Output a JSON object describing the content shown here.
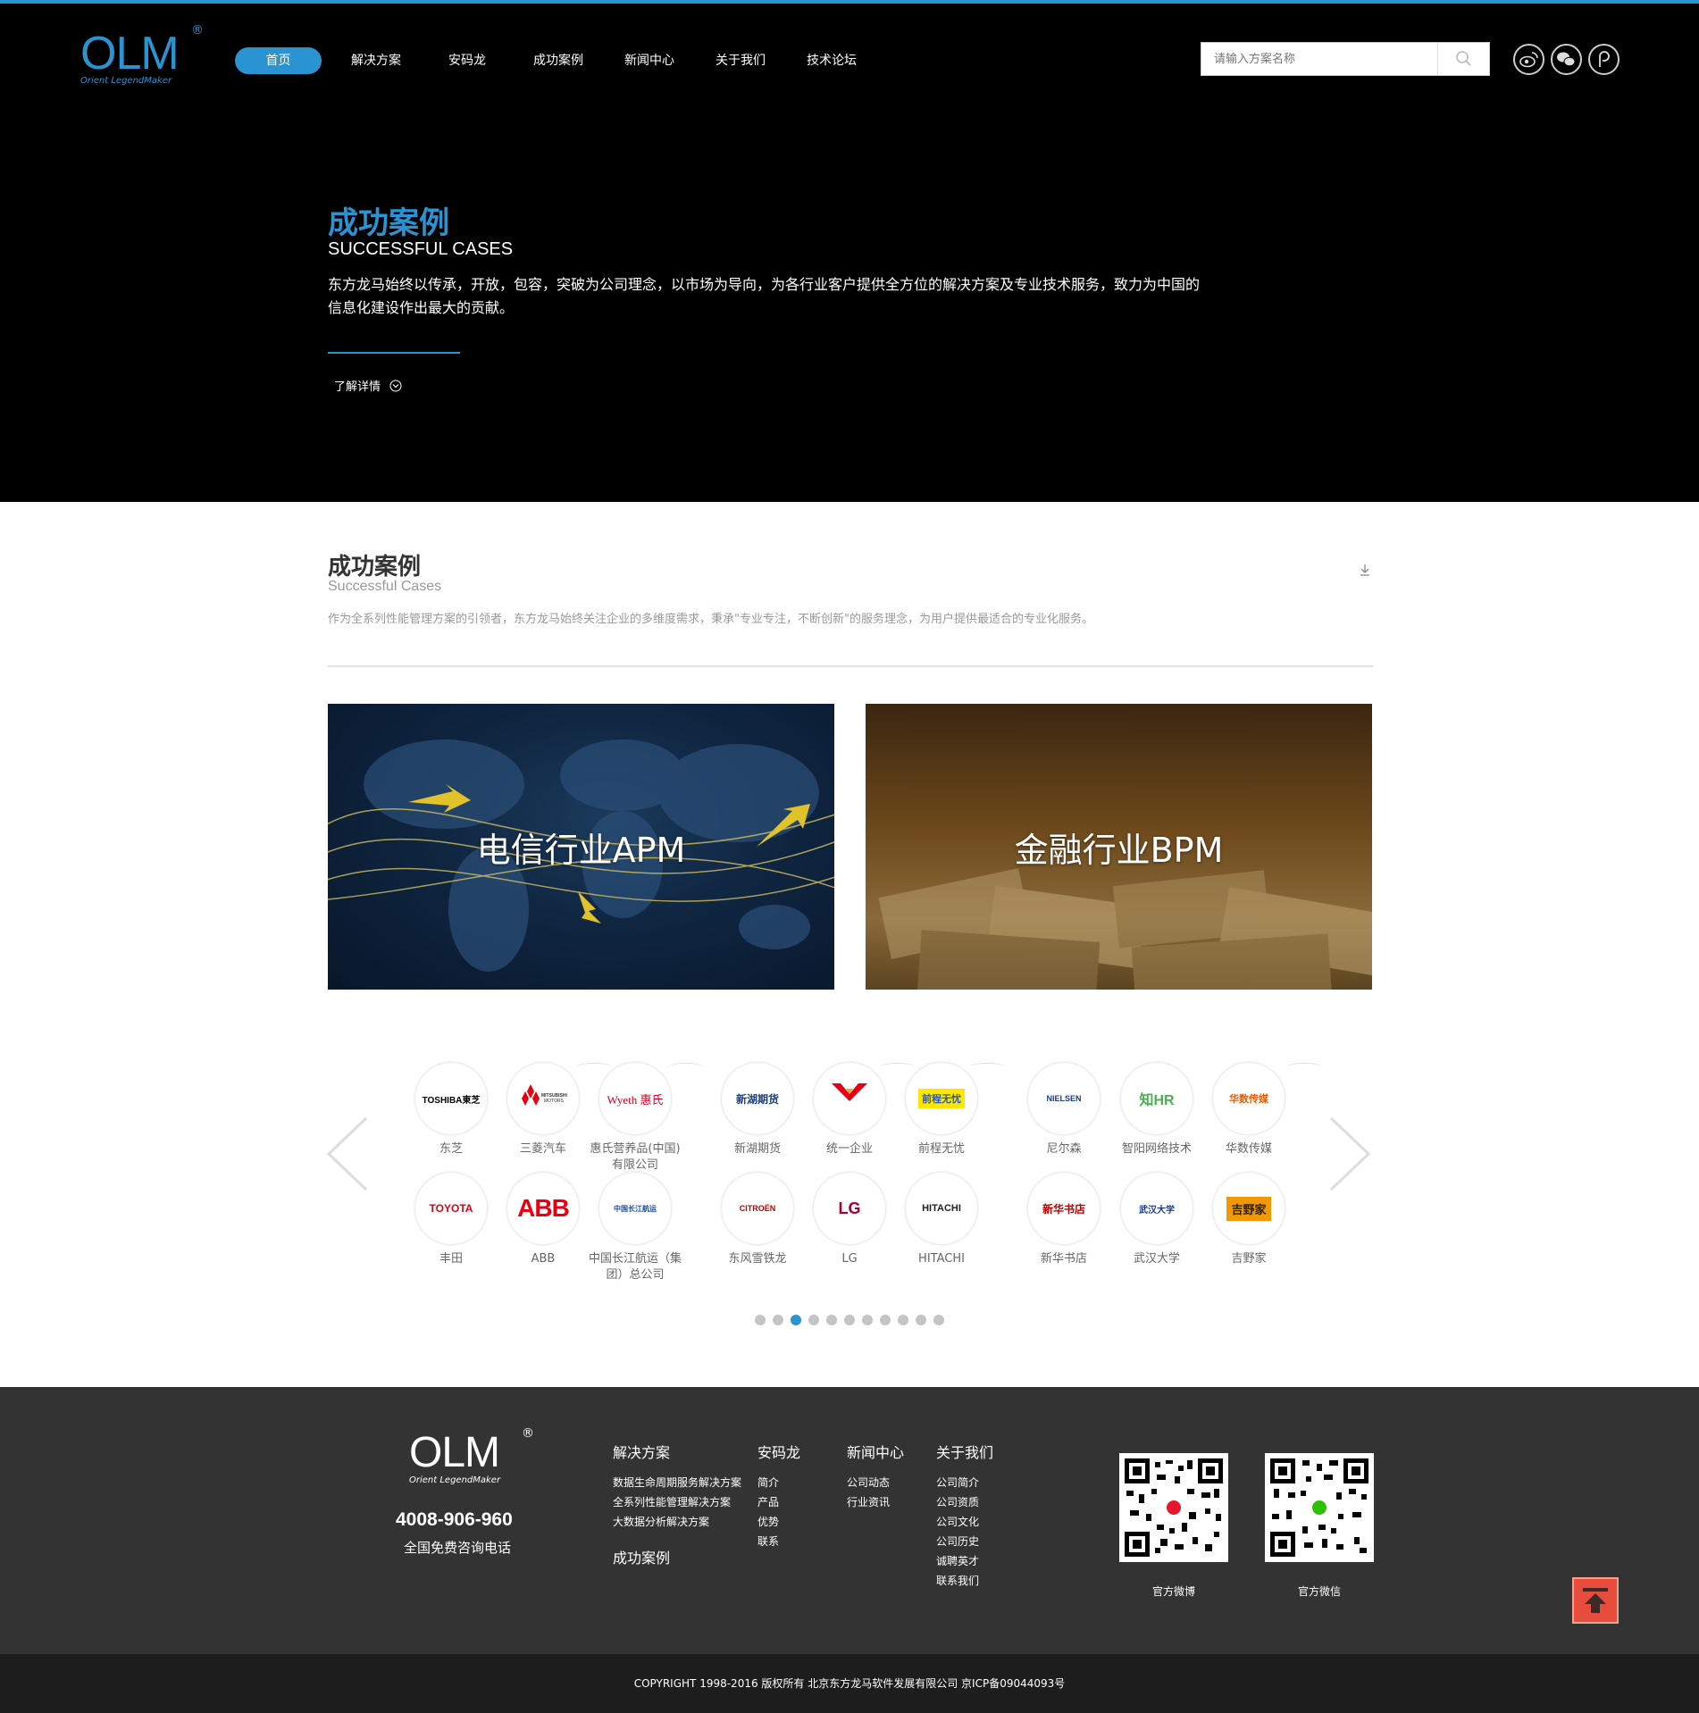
{
  "brand": {
    "logo_text": "OLM",
    "logo_tagline": "Orient LegendMaker",
    "registered_mark": "®",
    "accent_color": "#2a93d1"
  },
  "nav": {
    "items": [
      "首页",
      "解决方案",
      "安码龙",
      "成功案例",
      "新闻中心",
      "关于我们",
      "技术论坛"
    ],
    "active_index": 0
  },
  "search": {
    "placeholder": "请输入方案名称",
    "icon": "search-icon"
  },
  "social": {
    "icons": [
      "weibo-icon",
      "wechat-icon",
      "forum-icon"
    ]
  },
  "hero": {
    "title": "成功案例",
    "subtitle": "SUCCESSFUL CASES",
    "description": "东方龙马始终以传承，开放，包容，突破为公司理念，以市场为导向，为各行业客户提供全方位的解决方案及专业技术服务，致力为中国的信息化建设作出最大的贡献。",
    "more_label": "了解详情"
  },
  "section": {
    "title": "成功案例",
    "subtitle": "Successful Cases",
    "description": "作为全系列性能管理方案的引领者，东方龙马始终关注企业的多维度需求，秉承\"专业专注，不断创新\"的服务理念，为用户提供最适合的专业化服务。"
  },
  "cases": [
    {
      "label": "电信行业APM"
    },
    {
      "label": "金融行业BPM"
    }
  ],
  "clients": {
    "row1": [
      {
        "name": "东芝",
        "logo_text": "TOSHIBA東芝",
        "color": "#e60012"
      },
      {
        "name": "三菱汽车",
        "logo_text": "MITSUBISHI MOTORS",
        "color": "#e60012"
      },
      {
        "name": "惠氏营养品(中国)有限公司",
        "logo_text": "Wyeth 惠氏",
        "color": "#d6001c"
      },
      {
        "name": "新湖期货",
        "logo_text": "新湖期货",
        "color": "#1b3f7a"
      },
      {
        "name": "统一企业",
        "logo_text": "统一企业",
        "color": "#e60012"
      },
      {
        "name": "前程无忧",
        "logo_text": "前程无忧",
        "color": "#2b59a8"
      },
      {
        "name": "尼尔森",
        "logo_text": "NIELSEN",
        "color": "#1a3a8a"
      },
      {
        "name": "智阳网络技术",
        "logo_text": "知HR",
        "color": "#4caf50"
      },
      {
        "name": "华数传媒",
        "logo_text": "华数传媒",
        "color": "#e65c00"
      }
    ],
    "row2": [
      {
        "name": "丰田",
        "logo_text": "TOYOTA",
        "color": "#e60012"
      },
      {
        "name": "ABB",
        "logo_text": "ABB",
        "color": "#e60012"
      },
      {
        "name": "中国长江航运（集团）总公司",
        "logo_text": "中国长江航运",
        "color": "#1a4c9c"
      },
      {
        "name": "东风雪铁龙",
        "logo_text": "CITROËN",
        "color": "#c00000"
      },
      {
        "name": "LG",
        "logo_text": "LG",
        "color": "#a50034"
      },
      {
        "name": "HITACHI",
        "logo_text": "HITACHI",
        "color": "#222222"
      },
      {
        "name": "新华书店",
        "logo_text": "新华书店",
        "color": "#c00000"
      },
      {
        "name": "武汉大学",
        "logo_text": "武汉大学",
        "color": "#1a3a8a"
      },
      {
        "name": "吉野家",
        "logo_text": "吉野家",
        "color": "#f39800"
      }
    ]
  },
  "carousel": {
    "page_count": 11,
    "active_page": 2
  },
  "footer": {
    "phone": "4008-906-960",
    "phone_label": "全国免费咨询电话",
    "columns": [
      {
        "title": "解决方案",
        "links": [
          "数据生命周期服务解决方案",
          "全系列性能管理解决方案",
          "大数据分析解决方案"
        ],
        "extra_title": "成功案例"
      },
      {
        "title": "安码龙",
        "links": [
          "简介",
          "产品",
          "优势",
          "联系"
        ]
      },
      {
        "title": "新闻中心",
        "links": [
          "公司动态",
          "行业资讯"
        ]
      },
      {
        "title": "关于我们",
        "links": [
          "公司简介",
          "公司资质",
          "公司文化",
          "公司历史",
          "诚聘英才",
          "联系我们"
        ]
      }
    ],
    "qr": [
      {
        "label": "官方微博",
        "icon": "weibo-icon",
        "color": "#e6162d"
      },
      {
        "label": "官方微信",
        "icon": "wechat-icon",
        "color": "#2dc100"
      }
    ],
    "back_to_top_color": "#e74c3c",
    "copyright": "COPYRIGHT 1998-2016 版权所有 北京东方龙马软件发展有限公司 京ICP备09044093号"
  }
}
